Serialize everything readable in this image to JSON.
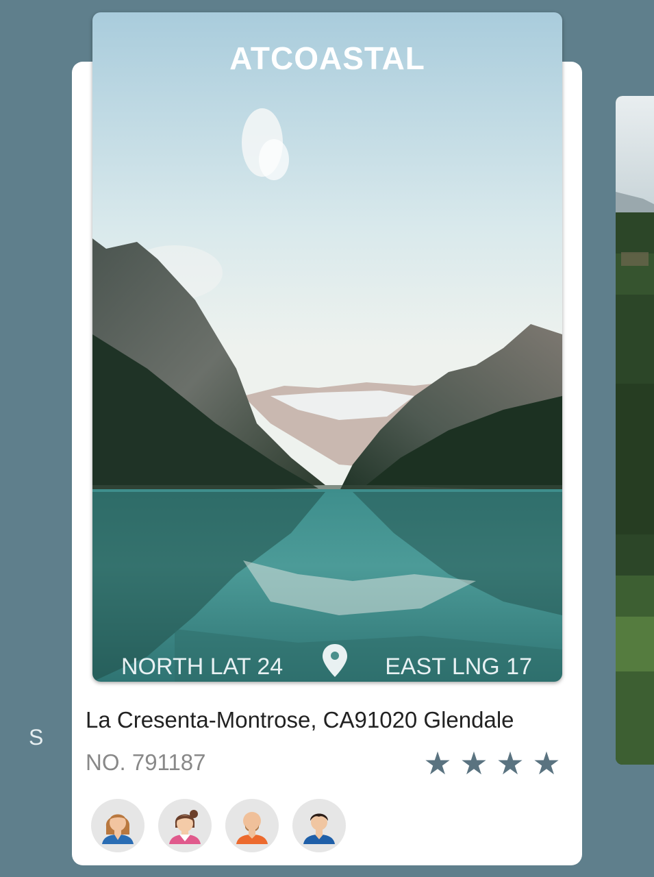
{
  "card": {
    "title": "ATCOASTAL",
    "north_lat": "NORTH LAT 24",
    "east_lng": "EAST LNG 17",
    "address": "La Cresenta-Montrose, CA91020 Glendale",
    "number": "NO. 791187",
    "rating": 4,
    "avatars": [
      "female-avatar-icon",
      "female-avatar-2-icon",
      "bald-male-avatar-icon",
      "male-avatar-icon"
    ]
  },
  "next_card": {
    "visible_text": "S"
  },
  "colors": {
    "background": "#5f7f8c",
    "card": "#ffffff",
    "star": "#5a7380"
  }
}
